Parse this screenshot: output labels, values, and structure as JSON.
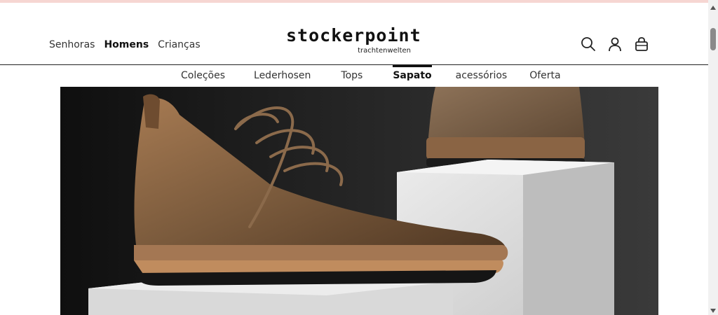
{
  "colors": {
    "accent": "#111111",
    "top_strip": "#f6d6d2",
    "hero_background": "#1a1a1a",
    "boot_leather": "#7a5a3c"
  },
  "audience_nav": [
    {
      "label": "Senhoras",
      "active": false
    },
    {
      "label": "Homens",
      "active": true
    },
    {
      "label": "Crianças",
      "active": false
    }
  ],
  "logo": {
    "main": "stockerpoint",
    "sub": "trachtenwelten"
  },
  "header_icons": [
    "search-icon",
    "user-icon",
    "shopping-bag-icon"
  ],
  "category_nav": [
    {
      "label": "Coleções",
      "active": false
    },
    {
      "label": "Lederhosen",
      "active": false
    },
    {
      "label": "Tops",
      "active": false
    },
    {
      "label": "Sapato",
      "active": true
    },
    {
      "label": "acessórios",
      "active": false
    },
    {
      "label": "Oferta",
      "active": false
    }
  ],
  "hero": {
    "subject": "brown suede leather boots on white pedestals"
  }
}
